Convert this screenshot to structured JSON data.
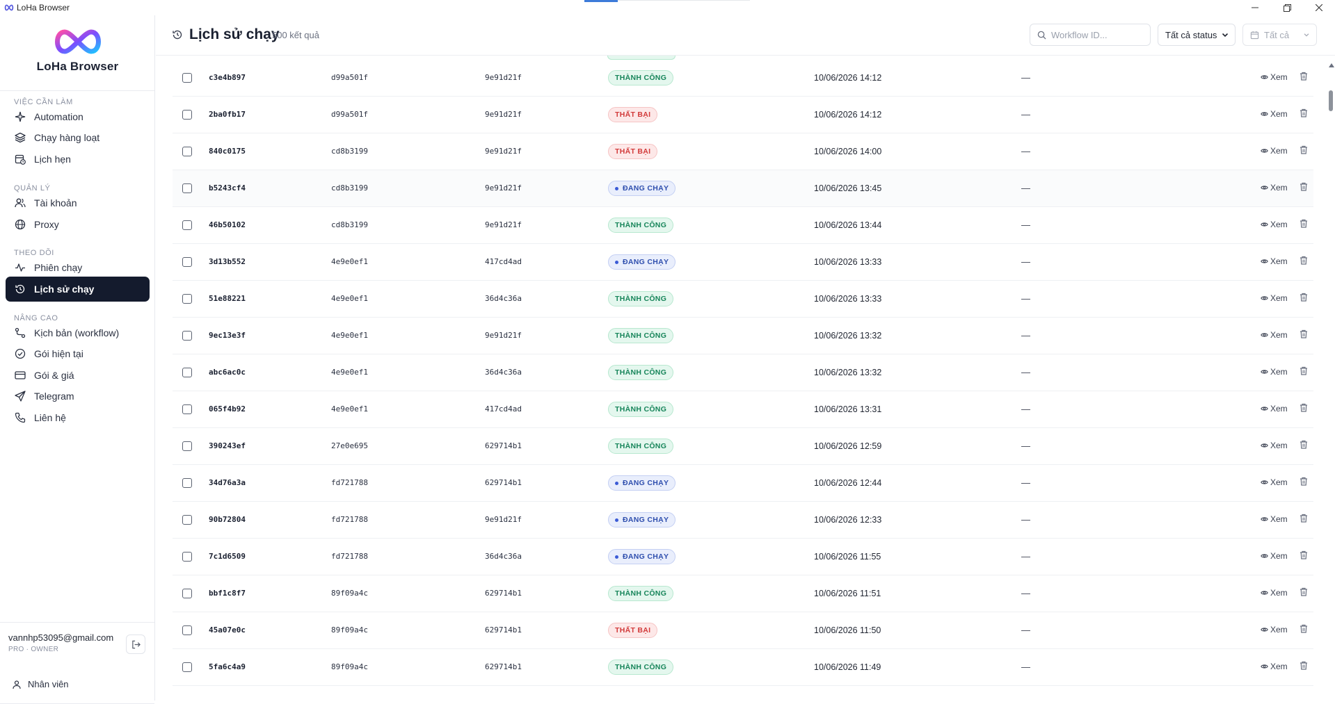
{
  "window": {
    "title": "LoHa Browser",
    "controls": [
      "minimize",
      "restore",
      "close"
    ]
  },
  "sidebar": {
    "brand": "LoHa Browser",
    "sections": [
      {
        "label": "VIỆC CẦN LÀM",
        "items": [
          {
            "label": "Automation",
            "icon": "sparkle-icon"
          },
          {
            "label": "Chạy hàng loạt",
            "icon": "layers-icon"
          },
          {
            "label": "Lịch hẹn",
            "icon": "calendar-clock-icon"
          }
        ]
      },
      {
        "label": "QUẢN LÝ",
        "items": [
          {
            "label": "Tài khoản",
            "icon": "users-icon"
          },
          {
            "label": "Proxy",
            "icon": "globe-icon"
          }
        ]
      },
      {
        "label": "THEO DÕI",
        "items": [
          {
            "label": "Phiên chạy",
            "icon": "activity-icon"
          },
          {
            "label": "Lịch sử chạy",
            "icon": "history-icon",
            "active": true
          }
        ]
      },
      {
        "label": "NÂNG CAO",
        "items": [
          {
            "label": "Kịch bản (workflow)",
            "icon": "workflow-icon"
          },
          {
            "label": "Gói hiện tại",
            "icon": "check-circle-icon"
          },
          {
            "label": "Gói & giá",
            "icon": "credit-card-icon"
          },
          {
            "label": "Telegram",
            "icon": "send-icon"
          },
          {
            "label": "Liên hệ",
            "icon": "phone-icon"
          }
        ]
      }
    ],
    "user": {
      "email": "vannhp53095@gmail.com",
      "plan": "PRO · OWNER",
      "staff_label": "Nhân viên"
    }
  },
  "header": {
    "title": "Lịch sử chạy",
    "count": "500 kết quả",
    "search_placeholder": "Workflow ID...",
    "status_filter": "Tất cả status",
    "date_filter": "Tất cả"
  },
  "status_colors": {
    "success": "#17855a",
    "failed": "#d23b3b",
    "running": "#2f4fae"
  },
  "table": {
    "view_label": "Xem",
    "rows": [
      {
        "id": "c3e4b897",
        "workflow": "d99a501f",
        "account": "9e91d21f",
        "status": "THÀNH CÔNG",
        "kind": "ok",
        "time": "10/06/2026 14:12",
        "duration": "—"
      },
      {
        "id": "2ba0fb17",
        "workflow": "d99a501f",
        "account": "9e91d21f",
        "status": "THẤT BẠI",
        "kind": "fail",
        "time": "10/06/2026 14:12",
        "duration": "—"
      },
      {
        "id": "840c0175",
        "workflow": "cd8b3199",
        "account": "9e91d21f",
        "status": "THẤT BẠI",
        "kind": "fail",
        "time": "10/06/2026 14:00",
        "duration": "—"
      },
      {
        "id": "b5243cf4",
        "workflow": "cd8b3199",
        "account": "9e91d21f",
        "status": "ĐANG CHẠY",
        "kind": "run",
        "time": "10/06/2026 13:45",
        "duration": "—"
      },
      {
        "id": "46b50102",
        "workflow": "cd8b3199",
        "account": "9e91d21f",
        "status": "THÀNH CÔNG",
        "kind": "ok",
        "time": "10/06/2026 13:44",
        "duration": "—"
      },
      {
        "id": "3d13b552",
        "workflow": "4e9e0ef1",
        "account": "417cd4ad",
        "status": "ĐANG CHẠY",
        "kind": "run",
        "time": "10/06/2026 13:33",
        "duration": "—"
      },
      {
        "id": "51e88221",
        "workflow": "4e9e0ef1",
        "account": "36d4c36a",
        "status": "THÀNH CÔNG",
        "kind": "ok",
        "time": "10/06/2026 13:33",
        "duration": "—"
      },
      {
        "id": "9ec13e3f",
        "workflow": "4e9e0ef1",
        "account": "9e91d21f",
        "status": "THÀNH CÔNG",
        "kind": "ok",
        "time": "10/06/2026 13:32",
        "duration": "—"
      },
      {
        "id": "abc6ac0c",
        "workflow": "4e9e0ef1",
        "account": "36d4c36a",
        "status": "THÀNH CÔNG",
        "kind": "ok",
        "time": "10/06/2026 13:32",
        "duration": "—"
      },
      {
        "id": "065f4b92",
        "workflow": "4e9e0ef1",
        "account": "417cd4ad",
        "status": "THÀNH CÔNG",
        "kind": "ok",
        "time": "10/06/2026 13:31",
        "duration": "—"
      },
      {
        "id": "390243ef",
        "workflow": "27e0e695",
        "account": "629714b1",
        "status": "THÀNH CÔNG",
        "kind": "ok",
        "time": "10/06/2026 12:59",
        "duration": "—"
      },
      {
        "id": "34d76a3a",
        "workflow": "fd721788",
        "account": "629714b1",
        "status": "ĐANG CHẠY",
        "kind": "run",
        "time": "10/06/2026 12:44",
        "duration": "—"
      },
      {
        "id": "90b72804",
        "workflow": "fd721788",
        "account": "9e91d21f",
        "status": "ĐANG CHẠY",
        "kind": "run",
        "time": "10/06/2026 12:33",
        "duration": "—"
      },
      {
        "id": "7c1d6509",
        "workflow": "fd721788",
        "account": "36d4c36a",
        "status": "ĐANG CHẠY",
        "kind": "run",
        "time": "10/06/2026 11:55",
        "duration": "—"
      },
      {
        "id": "bbf1c8f7",
        "workflow": "89f09a4c",
        "account": "629714b1",
        "status": "THÀNH CÔNG",
        "kind": "ok",
        "time": "10/06/2026 11:51",
        "duration": "—"
      },
      {
        "id": "45a07e0c",
        "workflow": "89f09a4c",
        "account": "629714b1",
        "status": "THẤT BẠI",
        "kind": "fail",
        "time": "10/06/2026 11:50",
        "duration": "—"
      },
      {
        "id": "5fa6c4a9",
        "workflow": "89f09a4c",
        "account": "629714b1",
        "status": "THÀNH CÔNG",
        "kind": "ok",
        "time": "10/06/2026 11:49",
        "duration": "—"
      }
    ]
  }
}
